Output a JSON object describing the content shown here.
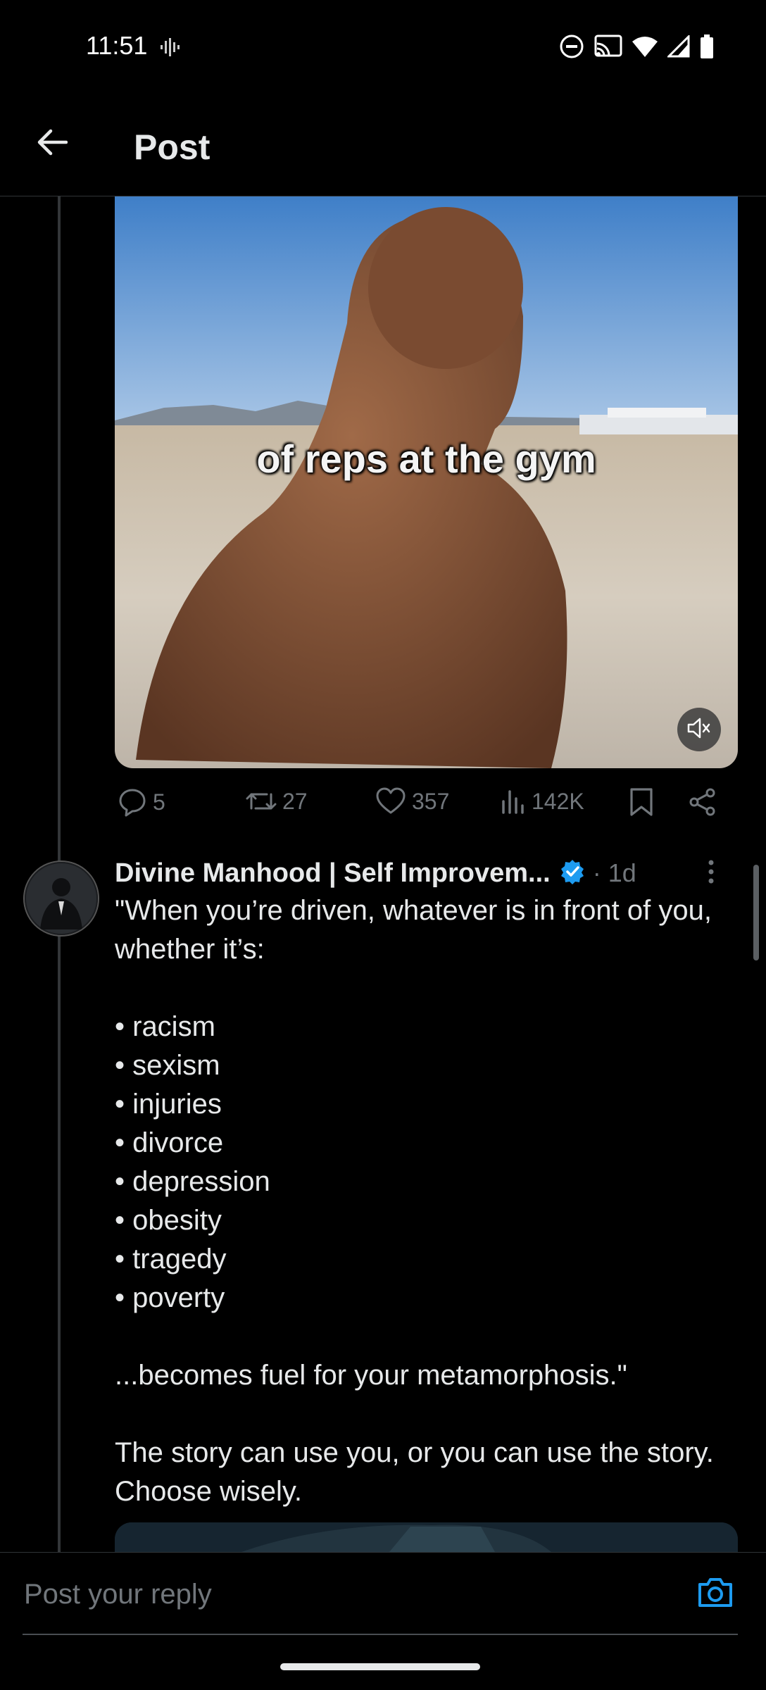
{
  "status_bar": {
    "time": "11:51",
    "left_icons": [
      "audio-wave-icon"
    ],
    "right_icons": [
      "do-not-disturb-icon",
      "cast-icon",
      "wifi-icon",
      "signal-icon",
      "battery-icon"
    ]
  },
  "header": {
    "back_icon": "arrow-left-icon",
    "title": "Post"
  },
  "video": {
    "caption": "of reps at the gym",
    "mute_icon": "volume-muted-icon"
  },
  "actions": {
    "replies": "5",
    "reposts": "27",
    "likes": "357",
    "views": "142K",
    "bookmark_icon": "bookmark-icon",
    "share_icon": "share-icon"
  },
  "post": {
    "author": "Divine Manhood | Self Improvem...",
    "time": "· 1d",
    "verified": true,
    "intro": "\"When you’re driven, whatever is in front of you, whether it’s:",
    "list": [
      "• racism",
      "• sexism",
      "• injuries",
      "• divorce",
      "• depression",
      "• obesity",
      "• tragedy",
      "• poverty"
    ],
    "quote_end": "...becomes fuel for your metamorphosis.\"",
    "closing": "The story can use you, or you can use the story. Choose wisely."
  },
  "reply": {
    "placeholder": "Post your reply",
    "camera_icon": "camera-icon"
  },
  "colors": {
    "background": "#000000",
    "text": "#e7e9ea",
    "muted": "#71767b",
    "accent": "#1d9bf0",
    "divider": "#2f3336"
  }
}
